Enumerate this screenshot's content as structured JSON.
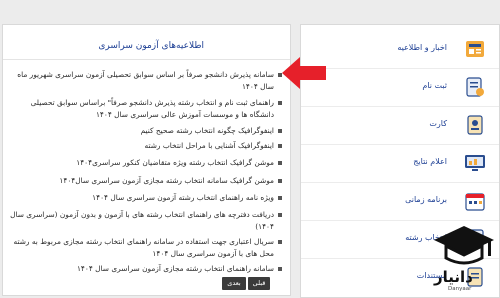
{
  "announcements": {
    "title": "اطلاعیه‌های آزمون سراسری",
    "items": [
      "سامانه پذیرش دانشجو صرفاً بر اساس سوابق تحصیلی آزمون سراسری شهریور ماه سال ۱۴۰۴",
      "راهنمای ثبت نام و انتخاب رشته پذیرش دانشجو صرفاً\" براساس سوابق تحصیلی دانشگاه ها و موسسات آموزش عالی سراسری سال ۱۴۰۴",
      "اینفوگرافیک چگونه انتخاب رشته صحیح کنیم",
      "اینفوگرافیک آشنایی با مراحل انتخاب رشته",
      "موشن گرافیک انتخاب رشته ویژه متقاضیان کنکور سراسری۱۴۰۴",
      "موشن گرافیک سامانه انتخاب رشته مجازی آزمون سراسری سال۱۴۰۴",
      "ویژه نامه راهنمای انتخاب رشته آزمون سراسری سال ۱۴۰۴",
      "دریافت دفترچه های راهنمای انتخاب رشته های با آزمون و بدون آزمون (سراسری سال ۱۴۰۴)",
      "سریال اعتباری جهت استفاده در سامانه راهنمای انتخاب رشته مجازی مربوط به رشته محل های با آزمون سراسری سال ۱۴۰۴",
      "سامانه راهنمای انتخاب رشته مجازی آزمون سراسری سال ۱۴۰۴"
    ]
  },
  "pager": {
    "next": "بعدی",
    "prev": "قبلی"
  },
  "sidebar": {
    "items": [
      {
        "label": "اخبار و اطلاعیه",
        "icon": "newspaper-icon"
      },
      {
        "label": "ثبت نام",
        "icon": "registration-icon"
      },
      {
        "label": "کارت",
        "icon": "id-card-icon"
      },
      {
        "label": "اعلام نتایج",
        "icon": "results-monitor-icon"
      },
      {
        "label": "برنامه زمانی",
        "icon": "calendar-icon"
      },
      {
        "label": "انتخاب رشته",
        "icon": "field-selection-icon"
      },
      {
        "label": "مستندات",
        "icon": "documents-icon"
      }
    ]
  },
  "logo": {
    "text": "دانیار",
    "sub": "Danyaar"
  },
  "colors": {
    "accent": "#1b3d93",
    "arrow": "#e6202a",
    "pager": "#3b3b3b"
  }
}
